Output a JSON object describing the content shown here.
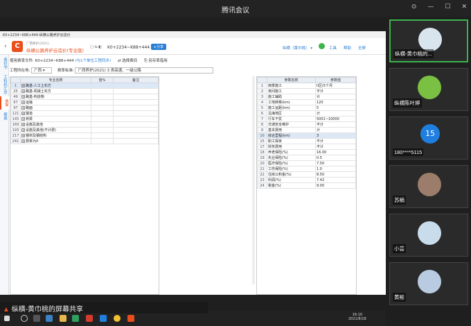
{
  "meeting": {
    "title": "腾讯会议",
    "sharer_label": "纵横-黄巾桃的屏幕共享"
  },
  "app": {
    "window_title": "K0+2234~K88+444-纵横公路养护云造价",
    "name_small": "广西养护(2021)",
    "name": "纵横公路养护云造价(专业版)",
    "project_code": "K0+2234~K88+444",
    "share_label": "分享",
    "user_menu": "纵横（黄巾桃）",
    "tools": [
      "工具",
      "帮助",
      "全屏"
    ],
    "file_label": "使用费率文件:",
    "file_name": "K0+2234~K88+444",
    "file_link": "(与1个单位工程同步)",
    "btn_select": "选择费目",
    "btn_save_as": "另存率借用",
    "region_label": "工程所在地:",
    "region_value": "广西",
    "standard_label": "费率标准:",
    "standard_value": "广西养护(2021) 3 类高速、一级公路",
    "side_tabs": [
      "造价书",
      "工料机汇总",
      "费率",
      "报表"
    ],
    "active_side_tab": 2
  },
  "left_table": {
    "headers": [
      "",
      "专业名称",
      "值%",
      "备注"
    ],
    "rows": [
      [
        "1",
        "路基-人工土石方",
        "",
        ""
      ],
      [
        "25",
        "路基-机械土石方",
        "",
        ""
      ],
      [
        "49",
        "路基-构造物",
        "",
        ""
      ],
      [
        "67",
        "运输",
        "",
        ""
      ],
      [
        "97",
        "路面",
        "",
        ""
      ],
      [
        "121",
        "隧道",
        "",
        ""
      ],
      [
        "145",
        "桥梁",
        "",
        ""
      ],
      [
        "169",
        "设施及其他",
        "",
        ""
      ],
      [
        "193",
        "设施及其他(不计费)",
        "",
        ""
      ],
      [
        "217",
        "钢材及钢结构",
        "",
        ""
      ],
      [
        "241",
        "费率为0",
        "",
        ""
      ]
    ]
  },
  "right_table": {
    "headers": [
      "",
      "参数名称",
      "参数值"
    ],
    "rows": [
      [
        "1",
        "雨季施工",
        "II区(5个月"
      ],
      [
        "2",
        "夜间施工",
        "不计"
      ],
      [
        "3",
        "施工辅助",
        "计"
      ],
      [
        "4",
        "工地转移(km)",
        "120"
      ],
      [
        "5",
        "施工运距(km)",
        "5"
      ],
      [
        "6",
        "沿海地区",
        "计"
      ],
      [
        "7",
        "行车干扰",
        "5001~10000"
      ],
      [
        "8",
        "交通安全维护",
        "不计"
      ],
      [
        "9",
        "基本费用",
        "计"
      ],
      [
        "10",
        "综合里程(km)",
        "3"
      ],
      [
        "15",
        "职工探亲",
        "不计"
      ],
      [
        "17",
        "财务费用",
        "不计"
      ],
      [
        "18",
        "养老保险(%)",
        "16.00"
      ],
      [
        "19",
        "失业保险(%)",
        "0.5"
      ],
      [
        "20",
        "医疗保险(%)",
        "7.50"
      ],
      [
        "21",
        "工伤保险(%)",
        "1.0"
      ],
      [
        "22",
        "住房公积金(%)",
        "8.50"
      ],
      [
        "23",
        "利润(%)",
        "7.42"
      ],
      [
        "24",
        "税金(%)",
        "9.00"
      ]
    ]
  },
  "taskbar": {
    "time": "16:10",
    "date": "2021/8/18"
  },
  "participants": [
    {
      "name": "纵横-黄巾桃的...",
      "avatar_color": "#d8e4ee"
    },
    {
      "name": "纵横陈叶婷",
      "avatar_color": "#7ac143"
    },
    {
      "name": "180****5115",
      "avatar_num": "15"
    },
    {
      "name": "苏楠",
      "avatar_color": "#9c7c6a"
    },
    {
      "name": "小芸",
      "avatar_color": "#c8dceb"
    },
    {
      "name": "黄彬",
      "avatar_color": "#b8cbe0"
    }
  ]
}
